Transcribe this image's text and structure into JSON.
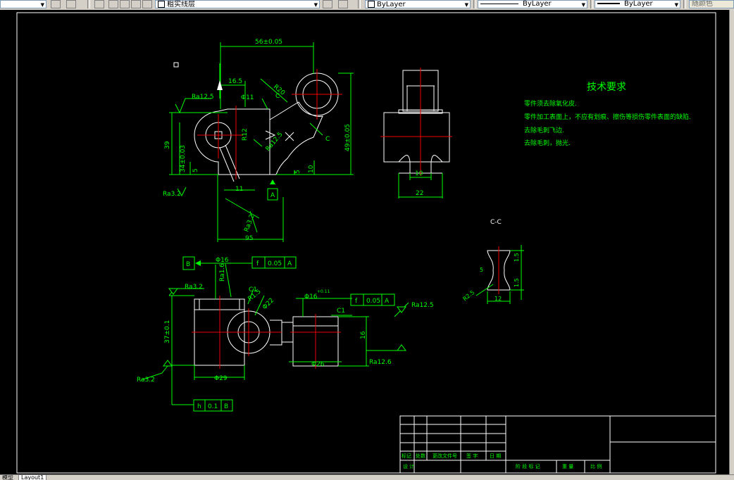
{
  "toolbar": {
    "layer_name": "粗实线层",
    "color": "ByLayer",
    "linetype": "ByLayer",
    "lineweight": "ByLayer",
    "plotstyle": "随颜色"
  },
  "tabs": {
    "model": "模型",
    "layout1": "Layout1"
  },
  "drawing": {
    "tech_title": "技术要求",
    "tech_notes": [
      "零件须去除氧化皮.",
      "零件加工表面上，不应有划痕、擦伤等损伤零件表面的缺陷.",
      "去除毛刺飞边.",
      "去除毛刺，抛光."
    ],
    "section_label": "C-C",
    "section_mark": "C",
    "dim_56": "56±0.05",
    "dim_16_5": "16.5",
    "dim_r20": "R20",
    "dim_39": "39",
    "dim_34": "34±0.03",
    "dim_5a": "5",
    "dim_5b": "5",
    "dim_10a": "10",
    "dim_49": "49±0.05",
    "dim_11": "11",
    "dim_95": "95",
    "dim_r12": "R12",
    "dim_phi11": "Φ11",
    "ra_12_5a": "Ra12.5",
    "ra_12_5b": "Ra12.5",
    "ra_3_2a": "Ra3.2",
    "ra_3_2b": "Ra3.2",
    "ra_3_2c": "Ra3.2",
    "ra_1_6": "Ra1.6",
    "ra_12_5c": "Ra12.5",
    "ra_12_5d": "Ra12.6",
    "datum_a": "A",
    "datum_b": "B",
    "dim_10b": "10",
    "dim_22": "22",
    "dim_phi16": "Φ16",
    "dim_c1a": "C1",
    "dim_c1b": "C1",
    "dim_r1_5": "R1.5",
    "dim_phi22": "Φ22",
    "dim_37": "37±0.1",
    "dim_29": "Φ29",
    "dim_phi16b": "Φ16",
    "dim_phi16_tol": "+0.11",
    "dim_26": "Φ26",
    "dim_16": "16",
    "gdt1": {
      "sym": "f",
      "tol": "0.05",
      "datum": "A"
    },
    "gdt2": {
      "sym": "f",
      "tol": "0.05",
      "datum": "A"
    },
    "gdt3": {
      "sym": "h",
      "tol": "0.1",
      "datum": "B"
    },
    "sec_5": "5",
    "sec_12": "12",
    "sec_r2_5": "R2.5",
    "sec_15a": "1.5",
    "sec_15b": "1.5",
    "tb_labels": [
      "标记",
      "处数",
      "更改文件号",
      "签 字",
      "日 期",
      "设 计",
      "阶 段 标 记",
      "重 量",
      "比 例"
    ]
  }
}
